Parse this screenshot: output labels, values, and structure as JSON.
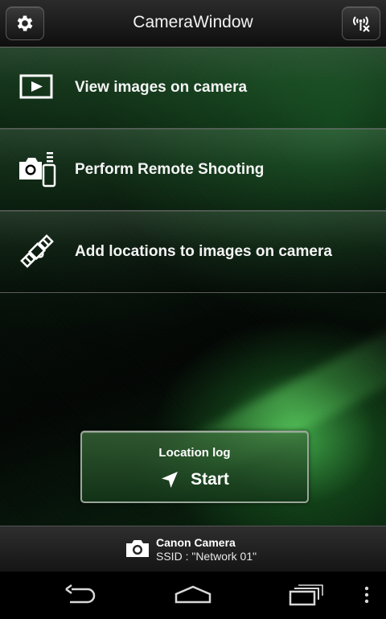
{
  "title_bar": {
    "title": "CameraWindow",
    "settings_icon": "gear-icon",
    "wireless_icon": "wireless-disconnect-icon"
  },
  "menu": {
    "items": [
      {
        "label": "View images on camera",
        "icon": "play-image-icon"
      },
      {
        "label": "Perform Remote Shooting",
        "icon": "camera-remote-icon"
      },
      {
        "label": "Add locations to images on camera",
        "icon": "satellite-icon"
      }
    ]
  },
  "location_log": {
    "title": "Location log",
    "start_label": "Start",
    "start_icon": "navigation-arrow-icon"
  },
  "status": {
    "camera_name": "Canon Camera",
    "ssid": "SSID : \"Network 01\"",
    "camera_icon": "camera-icon"
  },
  "nav": {
    "back_icon": "back-icon",
    "home_icon": "home-icon",
    "recents_icon": "recent-apps-icon",
    "menu_icon": "overflow-menu-icon"
  },
  "colors": {
    "accent_green": "#2fa84a",
    "title_bar": "#1c1c1c",
    "text": "#ffffff"
  }
}
